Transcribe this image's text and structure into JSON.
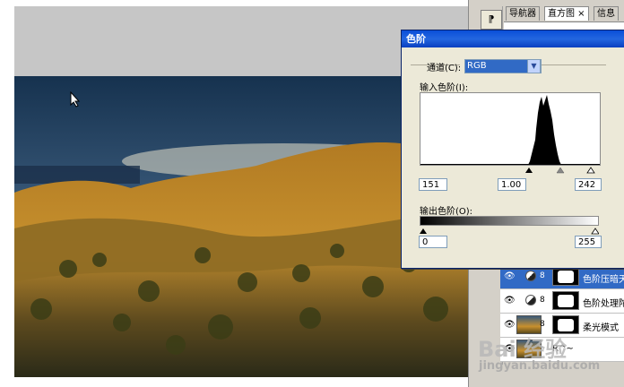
{
  "panels": {
    "tabs": [
      "导航器",
      "直方图 ×",
      "信息"
    ],
    "tool_button": "⁋"
  },
  "levels_dialog": {
    "title": "色阶",
    "channel_label": "通道(C):",
    "channel_value": "RGB",
    "input_label": "输入色阶(I):",
    "input_black": "151",
    "input_gamma": "1.00",
    "input_white": "242",
    "output_label": "输出色阶(O):",
    "output_black": "0",
    "output_white": "255"
  },
  "layers": [
    {
      "name": "色阶压暗天",
      "type": "adjustment",
      "selected": true
    },
    {
      "name": "色阶处理陀",
      "type": "adjustment",
      "selected": false
    },
    {
      "name": "柔光模式",
      "type": "image",
      "selected": false
    },
    {
      "name": "R^~",
      "type": "image",
      "selected": false
    }
  ],
  "watermark": {
    "main": "Bai 经验",
    "sub": "jingyan.baidu.com"
  },
  "colors": {
    "titlebar": "#0a4fd8",
    "selection": "#316ac5",
    "dialog_bg": "#ece9d8"
  }
}
